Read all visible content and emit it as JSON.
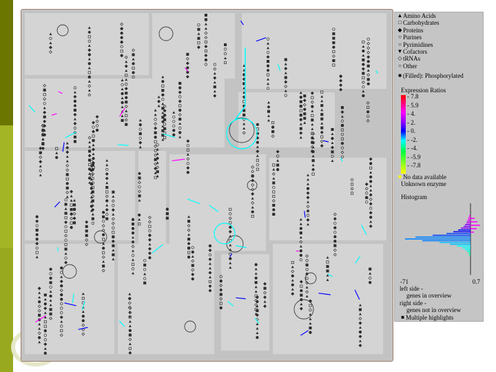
{
  "legend": {
    "categories": [
      {
        "symbol": "▲",
        "label": "Amino Acids"
      },
      {
        "symbol": "□",
        "label": "Carbohydrates"
      },
      {
        "symbol": "◆",
        "label": "Proteins"
      },
      {
        "symbol": "○",
        "label": "Purines"
      },
      {
        "symbol": "○",
        "label": "Pyrimidines"
      },
      {
        "symbol": "▼",
        "label": "Cofactors"
      },
      {
        "symbol": "◇",
        "label": "tRNAs"
      },
      {
        "symbol": "○",
        "label": "Other"
      }
    ],
    "filled_note_symbol": "■",
    "filled_note": "(Filled): Phosphorylated",
    "expression_title": "Expression Ratios",
    "ratio_ticks": [
      "7.8",
      "5.9",
      "4.",
      "2.",
      "0.",
      "-2.",
      "-4.",
      "-5.9",
      "-7.8"
    ],
    "no_data_symbol": "■",
    "no_data": "No data available",
    "unknown_enzyme": "Unknown enzyme",
    "histogram_title": "Histogram",
    "axis_min": "-71",
    "axis_max": "0.7",
    "notes": {
      "left_side": "left side -",
      "left_detail": "genes in overview",
      "right_side": "right side -",
      "right_detail": "genes not in overview",
      "multiple_symbol": "■",
      "multiple": "Multiple highlights"
    },
    "colors": {
      "high": "#ff0000",
      "mid_high": "#ff00ff",
      "mid": "#0000ff",
      "mid_low": "#00ffff",
      "low": "#ffff00"
    }
  }
}
